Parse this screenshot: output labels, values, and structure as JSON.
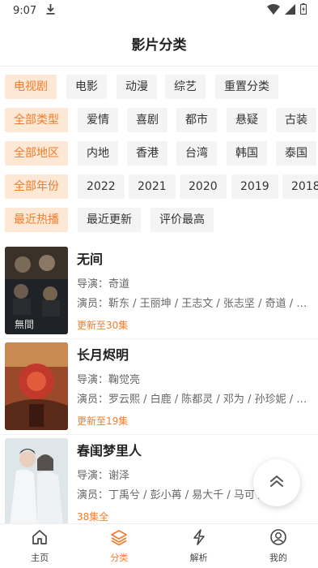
{
  "status_bar": {
    "time": "9:07",
    "icons": [
      "download-icon",
      "wifi-icon",
      "signal-icon",
      "battery-icon"
    ]
  },
  "header": {
    "title": "影片分类"
  },
  "filters": [
    [
      "电视剧",
      "电影",
      "动漫",
      "综艺",
      "重置分类"
    ],
    [
      "全部类型",
      "爱情",
      "喜剧",
      "都市",
      "悬疑",
      "古装"
    ],
    [
      "全部地区",
      "内地",
      "香港",
      "台湾",
      "韩国",
      "泰国"
    ],
    [
      "全部年份",
      "2022",
      "2021",
      "2020",
      "2019",
      "2018"
    ],
    [
      "最近热播",
      "最近更新",
      "评价最高"
    ]
  ],
  "movies": [
    {
      "title": "无间",
      "director": "导演：奇道",
      "cast": "演员：靳东 / 王丽坤 / 王志文 / 张志坚 / 奇道 / …",
      "status": "更新至30集"
    },
    {
      "title": "长月烬明",
      "director": "导演：鞠觉亮",
      "cast": "演员：罗云熙 / 白鹿 / 陈都灵 / 邓为 / 孙珍妮 / …",
      "status": "更新至19集"
    },
    {
      "title": "春闺梦里人",
      "director": "导演：谢泽",
      "cast": "演员：丁禹兮 / 彭小苒 / 易大千 / 马可 / …",
      "status": "38集全"
    }
  ],
  "tabbar": [
    {
      "label": "主页",
      "icon": "home-icon"
    },
    {
      "label": "分类",
      "icon": "layers-icon",
      "active": true
    },
    {
      "label": "解析",
      "icon": "lightning-icon"
    },
    {
      "label": "我的",
      "icon": "profile-icon"
    }
  ],
  "colors": {
    "accent": "#f07c2a",
    "chip_active_bg": "#fde8d6",
    "chip_bg": "#f4f4f4"
  }
}
